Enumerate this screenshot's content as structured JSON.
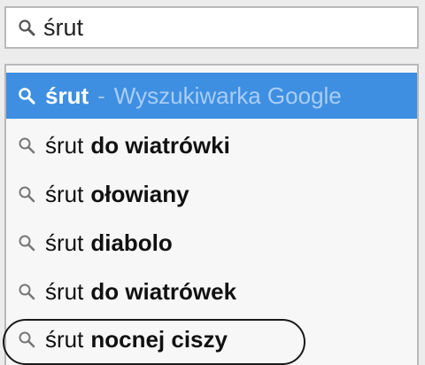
{
  "search": {
    "value": "śrut"
  },
  "suggestions": [
    {
      "query": "śrut",
      "suffix": "",
      "separator": "-",
      "engine": "Wyszukiwarka Google",
      "highlighted": true
    },
    {
      "query": "śrut",
      "suffix": "do wiatrówki"
    },
    {
      "query": "śrut",
      "suffix": "ołowiany"
    },
    {
      "query": "śrut",
      "suffix": "diabolo"
    },
    {
      "query": "śrut",
      "suffix": "do wiatrówek"
    },
    {
      "query": "śrut",
      "suffix": "nocnej ciszy",
      "circled": true
    }
  ],
  "colors": {
    "highlight": "#3e8fe1",
    "text": "#111111",
    "circle": "#1a1a1a"
  },
  "icons": {
    "search": "magnifier-icon"
  }
}
